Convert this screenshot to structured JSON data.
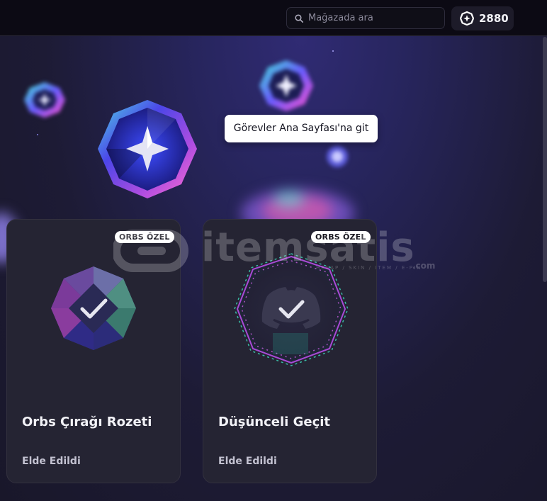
{
  "search": {
    "placeholder": "Mağazada ara"
  },
  "orbs": {
    "balance": "2880"
  },
  "tooltip": {
    "text": "Görevler Ana Sayfası'na git"
  },
  "watermark": {
    "text": "itemsatis",
    "subtext": "HESAP / SKIN / ITEM / E-PIN",
    "suffix": ".com"
  },
  "cards": [
    {
      "badge": "ORBS ÖZEL",
      "title": "Orbs Çırağı Rozeti",
      "status": "Elde Edildi"
    },
    {
      "badge": "ORBS ÖZEL",
      "title": "Düşünceli Geçit",
      "status": "Elde Edildi"
    }
  ],
  "colors": {
    "top_bar": "#0c0a14",
    "hero_accent": "#302b74",
    "card_bg": "#252433",
    "badge_bg": "#ffffff"
  },
  "icons": [
    "search-icon",
    "orb-icon",
    "checkmark-icon",
    "discord-logo-icon"
  ]
}
